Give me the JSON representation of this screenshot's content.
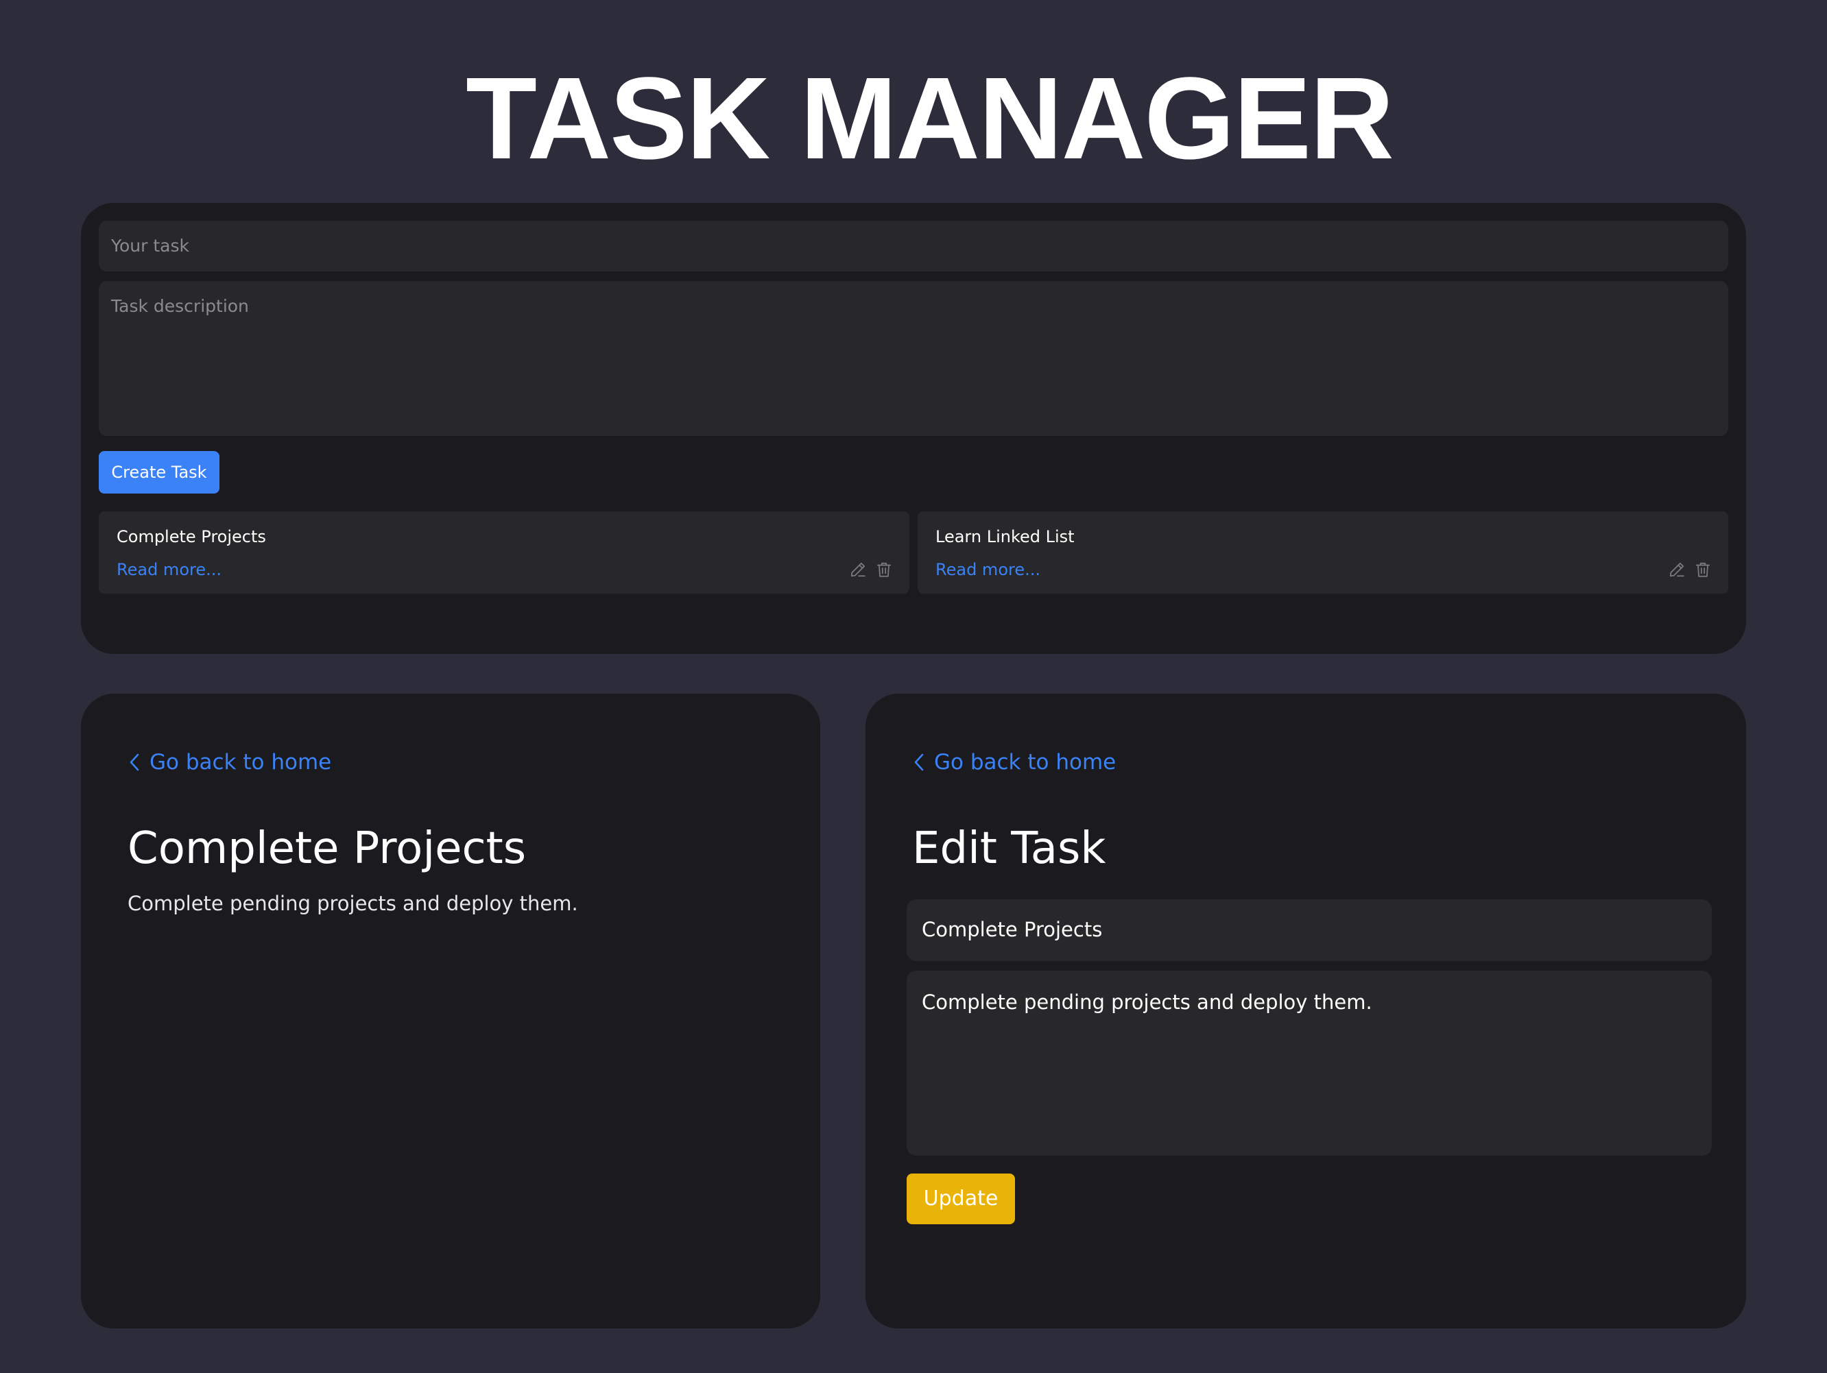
{
  "app": {
    "title": "TASK MANAGER"
  },
  "create_form": {
    "title_placeholder": "Your task",
    "description_placeholder": "Task description",
    "create_button_label": "Create Task"
  },
  "tasks": [
    {
      "title": "Complete Projects",
      "link_label": "Read more..."
    },
    {
      "title": "Learn Linked List",
      "link_label": "Read more..."
    }
  ],
  "detail_view": {
    "back_label": "Go back to home",
    "title": "Complete Projects",
    "description": "Complete pending projects and deploy them."
  },
  "edit_view": {
    "back_label": "Go back to home",
    "heading": "Edit Task",
    "title_value": "Complete Projects",
    "description_value": "Complete pending projects and deploy them.",
    "update_button_label": "Update"
  },
  "colors": {
    "page_background": "#2c2c3a",
    "panel_background": "#1b1b1f",
    "field_background": "#28282b",
    "accent_blue": "#3b82f6",
    "accent_yellow": "#eab308"
  },
  "icons": {
    "task_actions": [
      "pencil-icon",
      "trash-icon"
    ],
    "back": "chevron-left-icon"
  }
}
